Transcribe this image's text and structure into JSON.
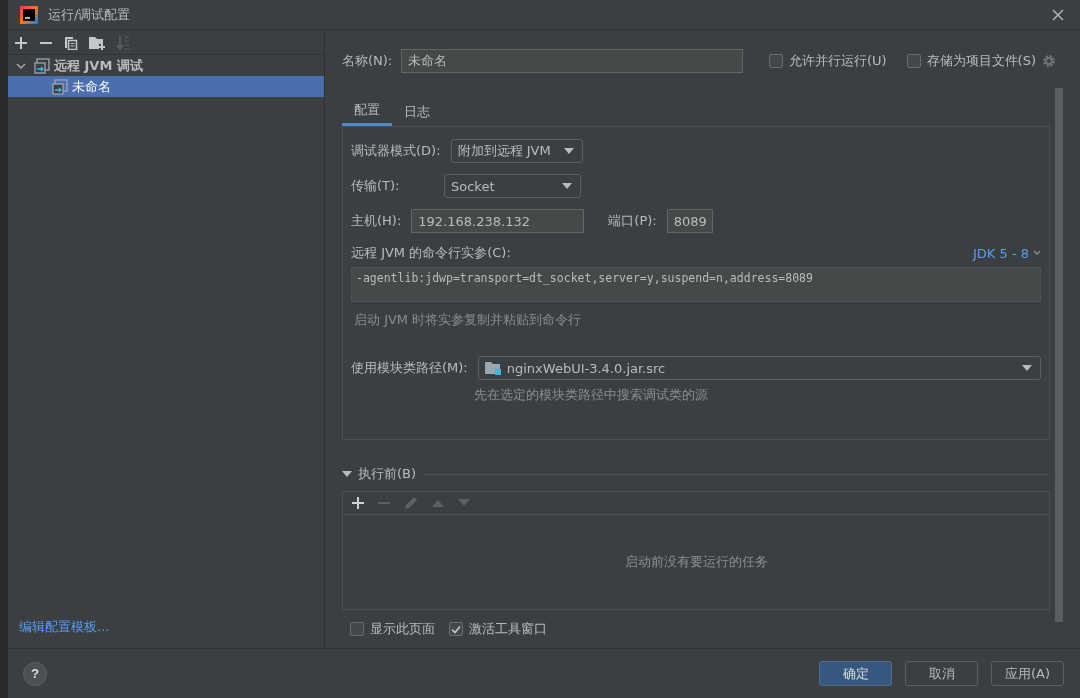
{
  "window": {
    "title": "运行/调试配置"
  },
  "toolbar": [
    {
      "kind": "add",
      "disabled": false
    },
    {
      "kind": "remove",
      "disabled": false
    },
    {
      "kind": "copy",
      "disabled": false
    },
    {
      "kind": "folder",
      "disabled": false
    },
    {
      "kind": "sort",
      "disabled": true
    }
  ],
  "tree": [
    {
      "label": "远程 JVM 调试",
      "expanded": true,
      "selected": false,
      "children": [
        {
          "label": "未命名",
          "selected": true
        }
      ]
    }
  ],
  "edit_templates_link": "编辑配置模板...",
  "name_field": {
    "label": "名称(N):",
    "value": "未命名"
  },
  "options": [
    {
      "label": "允许并行运行(U)",
      "checked": false
    },
    {
      "label": "存储为项目文件(S)",
      "checked": false
    }
  ],
  "tabs": [
    {
      "label": "配置",
      "selected": true
    },
    {
      "label": "日志",
      "selected": false
    }
  ],
  "debugger_mode": {
    "label": "调试器模式(D):",
    "value": "附加到远程 JVM"
  },
  "transport": {
    "label": "传输(T):",
    "value": "Socket"
  },
  "host": {
    "label": "主机(H):",
    "value": "192.168.238.132"
  },
  "port": {
    "label": "端口(P):",
    "value": "8089"
  },
  "command_line": {
    "label": "远程 JVM 的命令行实参(C):",
    "jdk": "JDK 5 - 8",
    "value": "-agentlib:jdwp=transport=dt_socket,server=y,suspend=n,address=8089",
    "hint": "启动 JVM 时将实参复制并粘贴到命令行"
  },
  "module_classpath": {
    "label": "使用模块类路径(M):",
    "value": "nginxWebUI-3.4.0.jar.src",
    "hint": "先在选定的模块类路径中搜索调试类的源"
  },
  "before_launch": {
    "title": "执行前(B)",
    "expanded": true,
    "empty_text": "启动前没有要运行的任务",
    "tools": [
      {
        "kind": "add",
        "disabled": false
      },
      {
        "kind": "remove",
        "disabled": true
      },
      {
        "kind": "edit",
        "disabled": true
      },
      {
        "kind": "up",
        "disabled": true
      },
      {
        "kind": "down",
        "disabled": true
      }
    ]
  },
  "footer_options": [
    {
      "label": "显示此页面",
      "checked": false
    },
    {
      "label": "激活工具窗口",
      "checked": true
    }
  ],
  "help_button": {
    "label": "?"
  },
  "buttons": [
    {
      "label": "确定",
      "kind": "primary"
    },
    {
      "label": "取消",
      "kind": "normal"
    },
    {
      "label": "应用(A)",
      "kind": "normal"
    }
  ]
}
